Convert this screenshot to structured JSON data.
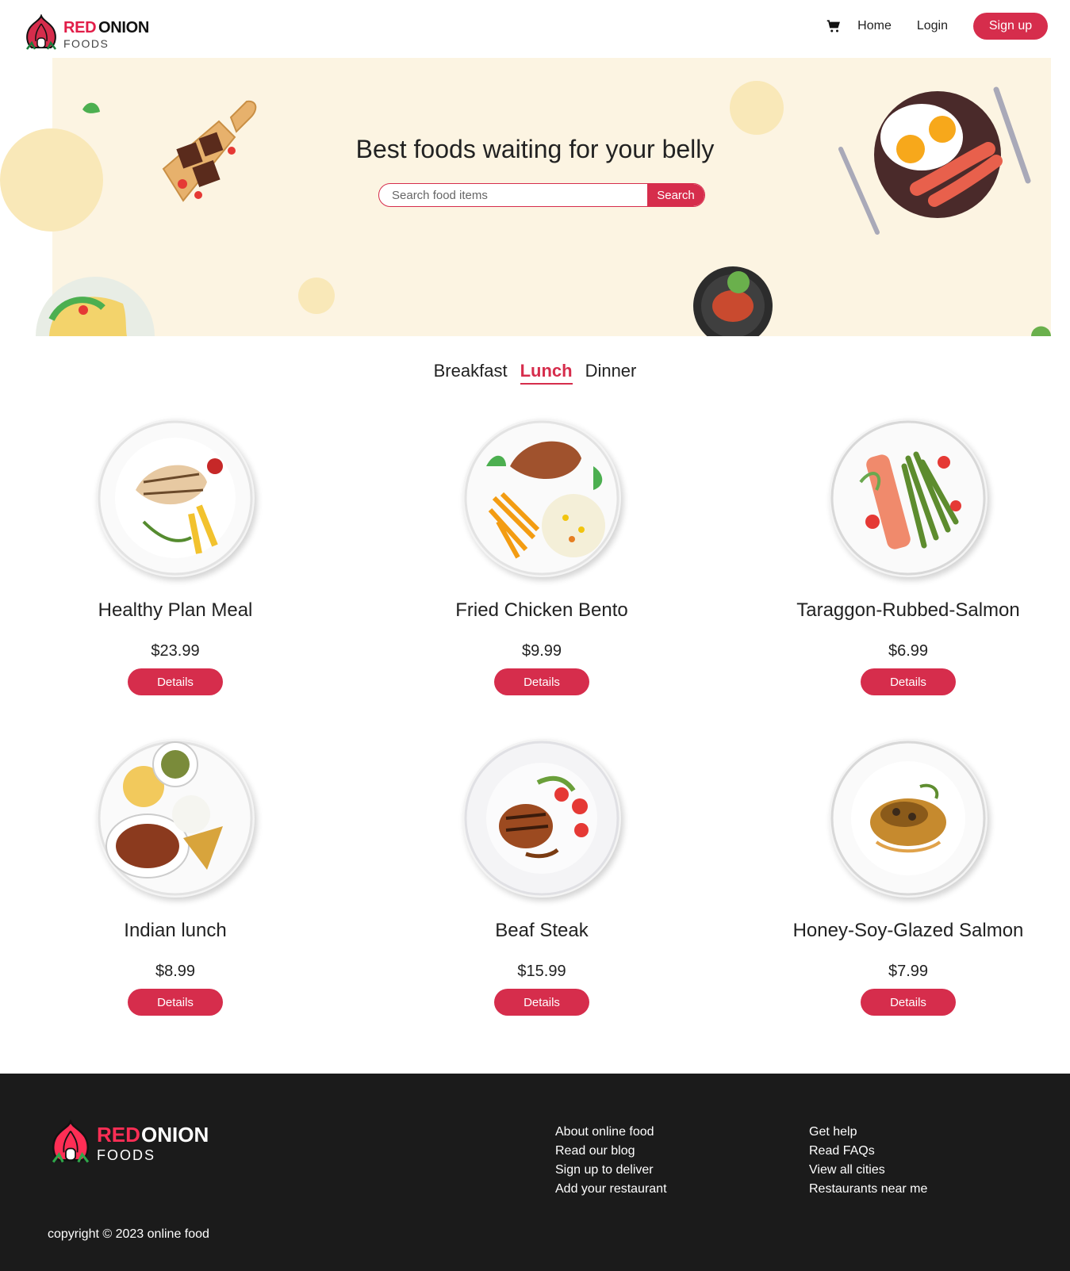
{
  "header": {
    "logo": {
      "word1": "RED",
      "word2": "ONION",
      "word3": "FOODS"
    },
    "nav": {
      "home": "Home",
      "login": "Login",
      "signup": "Sign up"
    },
    "cart_icon": "shopping-cart-icon"
  },
  "hero": {
    "title": "Best foods waiting for your belly",
    "search_placeholder": "Search food items",
    "search_button": "Search"
  },
  "tabs": {
    "items": [
      "Breakfast",
      "Lunch",
      "Dinner"
    ],
    "active": "Lunch"
  },
  "foods": [
    {
      "name": "Healthy Plan Meal",
      "price": "$23.99",
      "button": "Details"
    },
    {
      "name": "Fried Chicken Bento",
      "price": "$9.99",
      "button": "Details"
    },
    {
      "name": "Taraggon-Rubbed-Salmon",
      "price": "$6.99",
      "button": "Details"
    },
    {
      "name": "Indian lunch",
      "price": "$8.99",
      "button": "Details"
    },
    {
      "name": "Beaf Steak",
      "price": "$15.99",
      "button": "Details"
    },
    {
      "name": "Honey-Soy-Glazed Salmon",
      "price": "$7.99",
      "button": "Details"
    }
  ],
  "footer": {
    "logo": {
      "word1": "RED",
      "word2": "ONION",
      "word3": "FOODS"
    },
    "col1": [
      "About online food",
      "Read our blog",
      "Sign up to deliver",
      "Add your restaurant"
    ],
    "col2": [
      "Get help",
      "Read FAQs",
      "View all cities",
      "Restaurants near me"
    ],
    "copyright": "copyright © 2023 online food"
  },
  "colors": {
    "brand": "#d62d4c",
    "hero_bg": "#fcf4e2",
    "footer_bg": "#1b1b1b"
  }
}
